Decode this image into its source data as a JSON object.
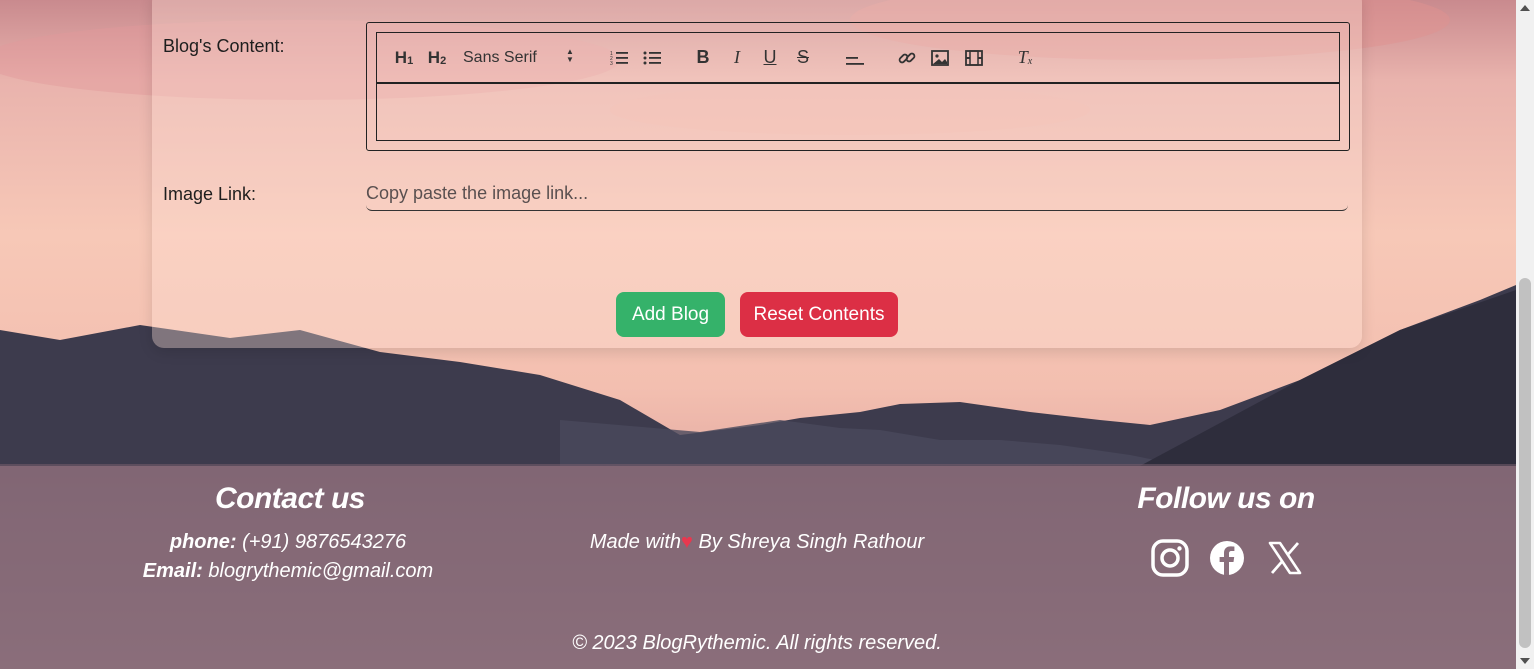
{
  "form": {
    "content_label": "Blog's Content:",
    "image_label": "Image Link:",
    "image_placeholder": "Copy paste the image link...",
    "image_value": "",
    "editor_body_value": "",
    "toolbar": {
      "h1": "H1",
      "h2": "H2",
      "font_select": "Sans Serif",
      "icons": [
        "ordered-list-icon",
        "bullet-list-icon",
        "bold-icon",
        "italic-icon",
        "underline-icon",
        "strikethrough-icon",
        "align-icon",
        "link-icon",
        "image-icon",
        "video-icon",
        "clear-format-icon"
      ]
    },
    "add_button": "Add Blog",
    "reset_button": "Reset Contents"
  },
  "footer": {
    "contact_title": "Contact us",
    "phone_label": "phone:",
    "phone_value": "(+91) 9876543276",
    "email_label": "Email:",
    "email_value": "blogrythemic@gmail.com",
    "made_with": "Made with",
    "made_by": "By Shreya Singh Rathour",
    "follow_title": "Follow us on",
    "social": [
      "instagram-icon",
      "facebook-icon",
      "x-icon"
    ],
    "copyright": "© 2023 BlogRythemic. All rights reserved."
  },
  "colors": {
    "add_button": "#35b26a",
    "reset_button": "#dc2f45",
    "heart": "#e8384f"
  }
}
